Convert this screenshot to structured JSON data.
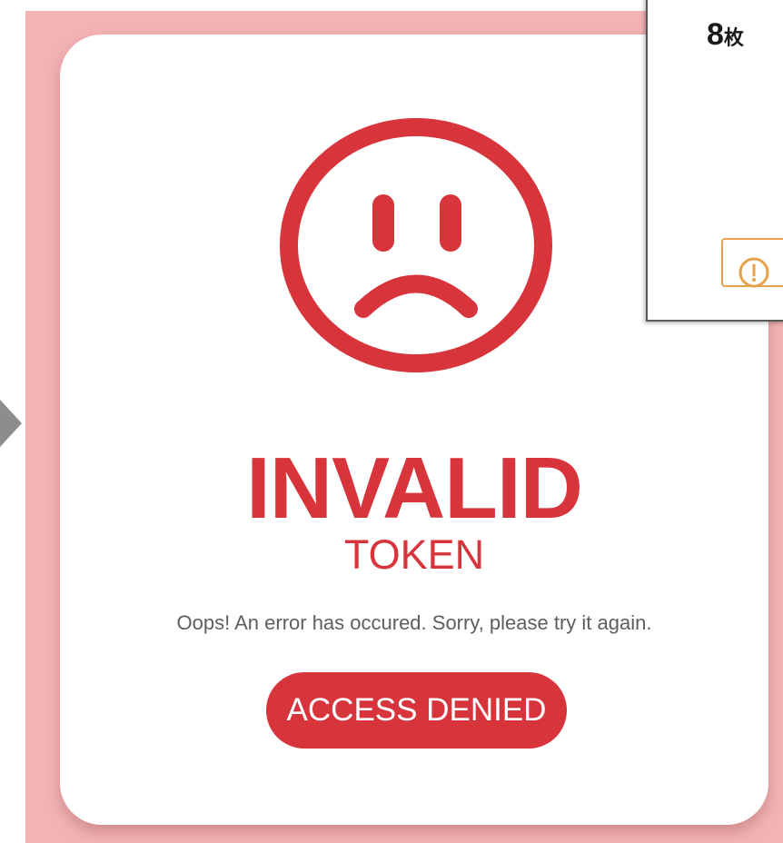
{
  "card": {
    "title": "INVALID",
    "subtitle": "TOKEN",
    "message": "Oops! An error has occured. Sorry, please try it again.",
    "button_label": "ACCESS DENIED"
  },
  "overlay_panel": {
    "count": "8",
    "count_unit": "枚"
  },
  "icons": {
    "face": "sad-face-icon",
    "warning": "warning-icon",
    "arrow": "arrow-right-icon"
  },
  "colors": {
    "accent": "#d8343c",
    "background": "#f3b3b5",
    "warning": "#e6a24a",
    "text_muted": "#5e5e5e"
  }
}
